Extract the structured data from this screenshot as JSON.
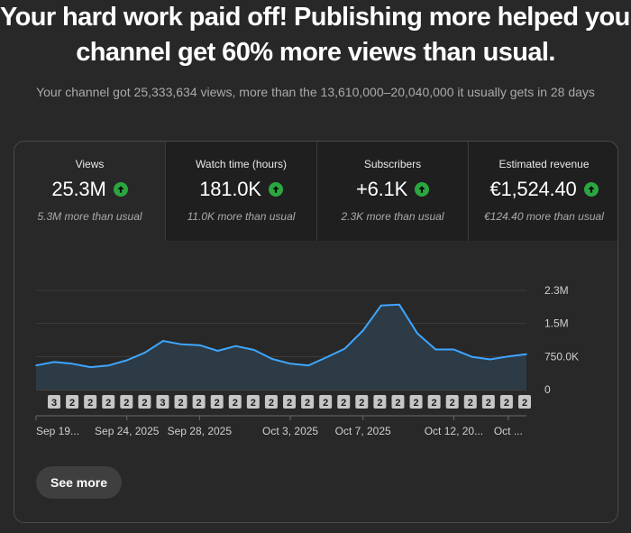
{
  "headline": {
    "line1": "Your hard work paid off! Publishing more helped your",
    "line2": "channel get 60% more views than usual."
  },
  "subline": "Your channel got 25,333,634 views, more than the 13,610,000–20,040,000 it usually gets in 28 days",
  "tabs": [
    {
      "label": "Views",
      "value": "25.3M",
      "note": "5.3M more than usual",
      "trend_icon": "arrow-up-icon",
      "active": true
    },
    {
      "label": "Watch time (hours)",
      "value": "181.0K",
      "note": "11.0K more than usual",
      "trend_icon": "arrow-up-icon",
      "active": false
    },
    {
      "label": "Subscribers",
      "value": "+6.1K",
      "note": "2.3K more than usual",
      "trend_icon": "arrow-up-icon",
      "active": false
    },
    {
      "label": "Estimated revenue",
      "value": "€1,524.40",
      "note": "€124.40 more than usual",
      "trend_icon": "arrow-up-icon",
      "active": false
    }
  ],
  "see_more_label": "See more",
  "colors": {
    "line": "#3ea6ff",
    "area": "#2c3b45",
    "trend_up": "#2ba640",
    "marker_badge": "#c6c6c6"
  },
  "chart_data": {
    "type": "area",
    "yticks": [
      "2.3M",
      "1.5M",
      "750.0K",
      "0"
    ],
    "ylim": [
      0,
      2300000
    ],
    "grid": true,
    "x": [
      "Sep 19",
      "Sep 20",
      "Sep 21",
      "Sep 22",
      "Sep 23",
      "Sep 24",
      "Sep 25",
      "Sep 26",
      "Sep 27",
      "Sep 28",
      "Sep 29",
      "Sep 30",
      "Oct 1",
      "Oct 2",
      "Oct 3",
      "Oct 4",
      "Oct 5",
      "Oct 6",
      "Oct 7",
      "Oct 8",
      "Oct 9",
      "Oct 10",
      "Oct 11",
      "Oct 12",
      "Oct 13",
      "Oct 14",
      "Oct 15",
      "Oct 16"
    ],
    "x_tick_labels": [
      {
        "index": 0,
        "label": "Sep 19..."
      },
      {
        "index": 5,
        "label": "Sep 24, 2025"
      },
      {
        "index": 9,
        "label": "Sep 28, 2025"
      },
      {
        "index": 14,
        "label": "Oct 3, 2025"
      },
      {
        "index": 18,
        "label": "Oct 7, 2025"
      },
      {
        "index": 23,
        "label": "Oct 12, 20..."
      },
      {
        "index": 26,
        "label": "Oct ..."
      }
    ],
    "series": [
      {
        "values": [
          560000,
          640000,
          600000,
          520000,
          560000,
          680000,
          860000,
          1130000,
          1050000,
          1030000,
          900000,
          1010000,
          920000,
          710000,
          600000,
          560000,
          750000,
          950000,
          1370000,
          1950000,
          1970000,
          1300000,
          930000,
          930000,
          760000,
          700000,
          770000,
          820000
        ]
      }
    ],
    "markers": [
      "3",
      "2",
      "2",
      "2",
      "2",
      "2",
      "3",
      "2",
      "2",
      "2",
      "2",
      "2",
      "2",
      "2",
      "2",
      "2",
      "2",
      "2",
      "2",
      "2",
      "2",
      "2",
      "2",
      "2",
      "2",
      "2",
      "2"
    ]
  }
}
